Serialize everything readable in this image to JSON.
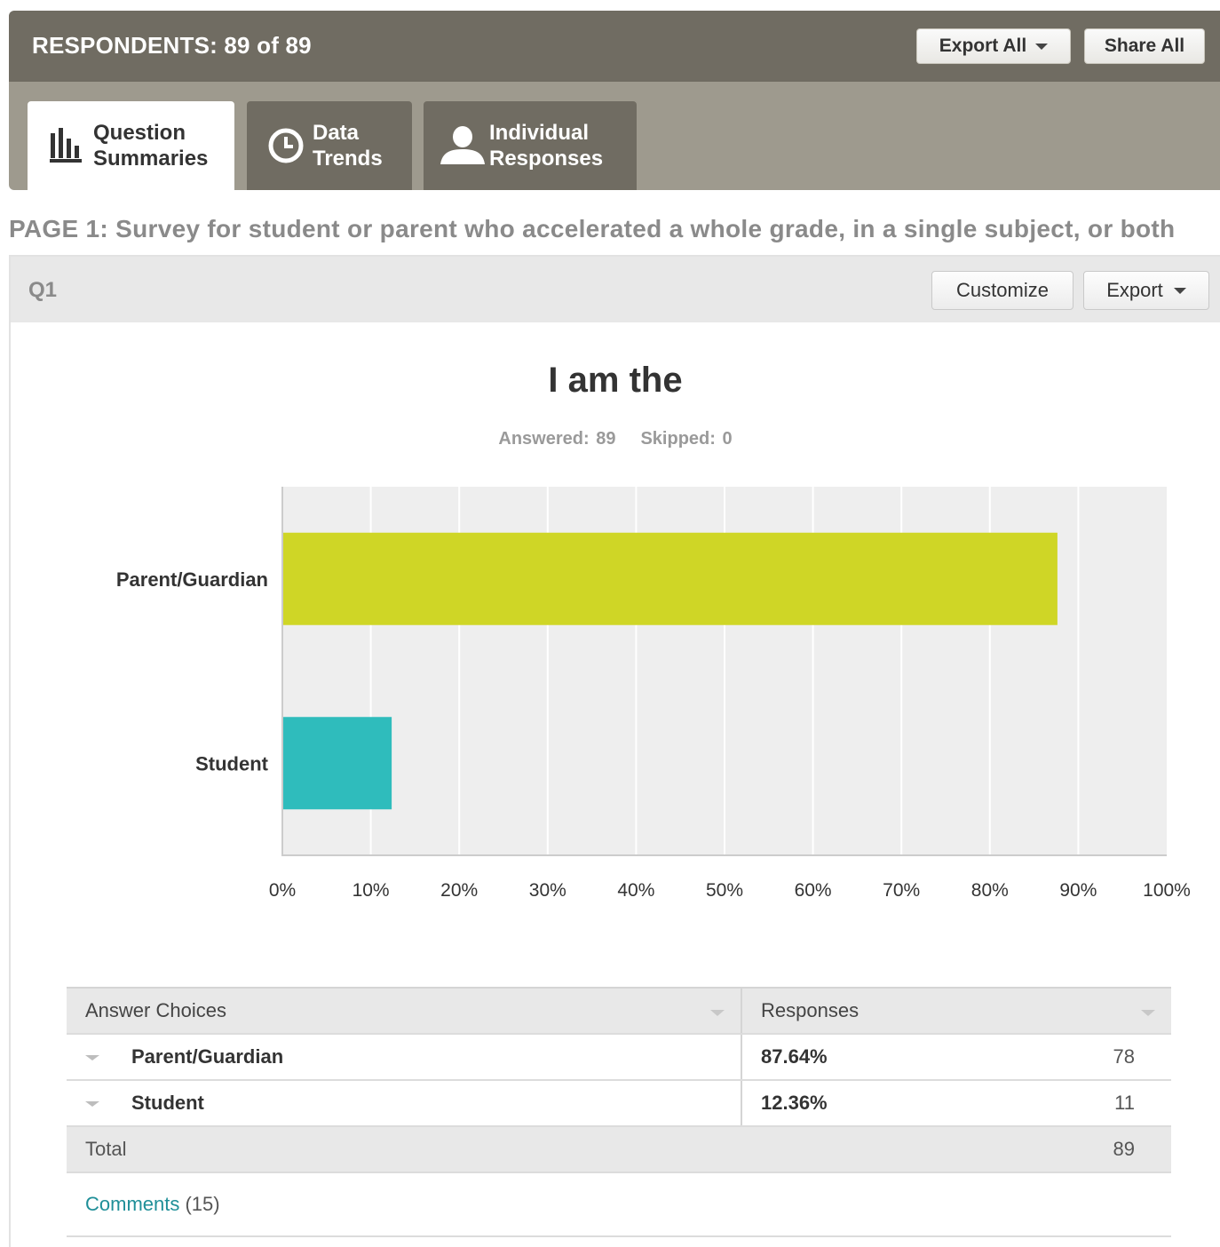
{
  "header": {
    "respondents": "RESPONDENTS: 89 of 89",
    "export_all": "Export All",
    "share_all": "Share All"
  },
  "tabs": [
    {
      "line1": "Question",
      "line2": "Summaries",
      "icon": "bar-chart-icon",
      "active": true
    },
    {
      "line1": "Data",
      "line2": "Trends",
      "icon": "clock-icon",
      "active": false
    },
    {
      "line1": "Individual",
      "line2": "Responses",
      "icon": "person-icon",
      "active": false
    }
  ],
  "page_heading": "PAGE 1: Survey for student or parent who accelerated a whole grade, in a single subject, or both",
  "question": {
    "number": "Q1",
    "customize": "Customize",
    "export": "Export",
    "title": "I am the",
    "answered": "Answered: 89",
    "skipped": "Skipped: 0"
  },
  "colors": {
    "header_dark": "#706c62",
    "header_light": "#9e9a8e",
    "bar_parent": "#cfd626",
    "bar_student": "#2fbcbc",
    "link": "#1f8f98"
  },
  "chart_data": {
    "type": "bar",
    "orientation": "horizontal",
    "categories": [
      "Parent/Guardian",
      "Student"
    ],
    "values": [
      87.64,
      12.36
    ],
    "colors": [
      "#cfd626",
      "#2fbcbc"
    ],
    "xlim": [
      0,
      100
    ],
    "x_ticks": [
      "0%",
      "10%",
      "20%",
      "30%",
      "40%",
      "50%",
      "60%",
      "70%",
      "80%",
      "90%",
      "100%"
    ],
    "grid": true
  },
  "table": {
    "headers": [
      "Answer Choices",
      "Responses"
    ],
    "rows": [
      {
        "choice": "Parent/Guardian",
        "percent": "87.64%",
        "count": "78"
      },
      {
        "choice": "Student",
        "percent": "12.36%",
        "count": "11"
      }
    ],
    "total_label": "Total",
    "total_count": "89",
    "comments_label": "Comments",
    "comments_count": "(15)"
  }
}
